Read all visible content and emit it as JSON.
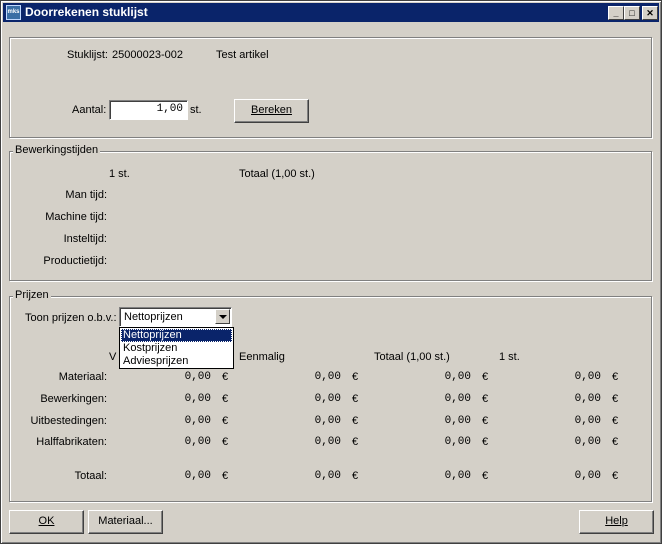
{
  "window": {
    "title": "Doorrekenen stuklijst",
    "icon_label": "mks",
    "controls": [
      "minimize-icon",
      "maximize-icon",
      "close-icon"
    ]
  },
  "header": {
    "stuklijst_label": "Stuklijst:",
    "stuklijst_code": "25000023-002",
    "stuklijst_name": "Test artikel",
    "aantal_label": "Aantal:",
    "aantal_value": "1,00",
    "aantal_unit": "st.",
    "bereken_button": "Bereken"
  },
  "bewerkingstijden": {
    "legend": "Bewerkingstijden",
    "col_unit": "1 st.",
    "col_total": "Totaal (1,00 st.)",
    "rows": [
      "Man tijd:",
      "Machine tijd:",
      "Insteltijd:",
      "Productietijd:"
    ]
  },
  "prijzen": {
    "legend": "Prijzen",
    "toon_label": "Toon prijzen o.b.v.:",
    "selected": "Nettoprijzen",
    "options": [
      "Nettoprijzen",
      "Kostprijzen",
      "Adviesprijzen"
    ],
    "col_v_partial": "V",
    "col_eenmalig": "Eenmalig",
    "col_total": "Totaal (1,00 st.)",
    "col_unit": "1 st.",
    "currency": "€",
    "rows": [
      {
        "label": "Materiaal:",
        "values": [
          "0,00",
          "0,00",
          "0,00",
          "0,00"
        ]
      },
      {
        "label": "Bewerkingen:",
        "values": [
          "0,00",
          "0,00",
          "0,00",
          "0,00"
        ]
      },
      {
        "label": "Uitbestedingen:",
        "values": [
          "0,00",
          "0,00",
          "0,00",
          "0,00"
        ]
      },
      {
        "label": "Halffabrikaten:",
        "values": [
          "0,00",
          "0,00",
          "0,00",
          "0,00"
        ]
      }
    ],
    "total": {
      "label": "Totaal:",
      "values": [
        "0,00",
        "0,00",
        "0,00",
        "0,00"
      ]
    }
  },
  "footer": {
    "ok_button": "OK",
    "materiaal_button": "Materiaal...",
    "help_button": "Help"
  }
}
